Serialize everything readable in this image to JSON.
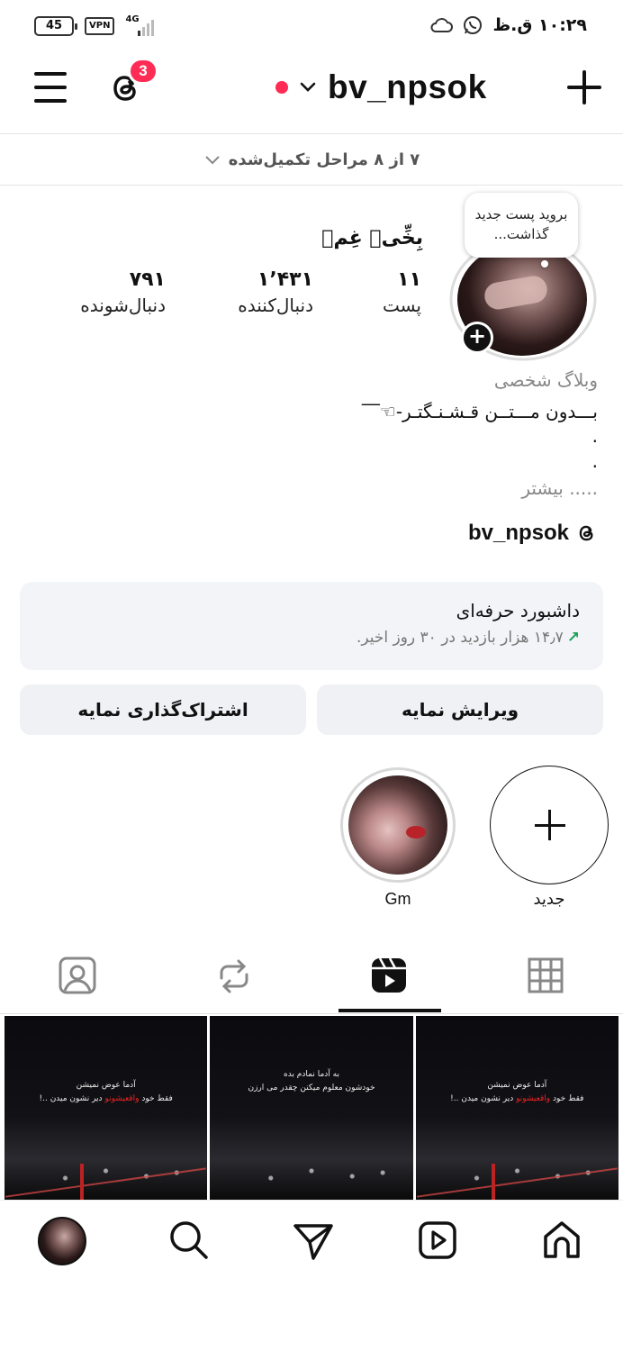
{
  "status_bar": {
    "battery": "45",
    "vpn": "VPN",
    "network": "4G",
    "time": "۱۰:۲۹ ق.ظ"
  },
  "header": {
    "username": "bv_npsok",
    "threads_badge": "3"
  },
  "setup_steps": {
    "text": "۷ از ۸ مراحل تکمیل‌شده"
  },
  "profile": {
    "note_bubble": "بروید پست جدید گذاشت...",
    "display_name": "بِخِّیٖ غِمٖ",
    "stats": [
      {
        "value": "۱۱",
        "label": "پست"
      },
      {
        "value": "۱٬۴۳۱",
        "label": "دنبال‌کننده"
      },
      {
        "value": "۷۹۱",
        "label": "دنبال‌شونده"
      }
    ],
    "category": "وبلاگ شخصی",
    "bio_line1": "بـــدون مـــتــن قـشـنـگتـر-☜‾‾",
    "bio_dot1": ".",
    "bio_dot2": ".",
    "more": "..... بیشتر",
    "threads_username": "bv_npsok"
  },
  "dashboard": {
    "title": "داشبورد حرفه‌ای",
    "stat": "۱۴٫۷ هزار بازدید در ۳۰ روز اخیر."
  },
  "buttons": {
    "edit_profile": "ویرایش نمایه",
    "share_profile": "اشتراک‌گذاری نمایه"
  },
  "highlights": [
    {
      "label": "جدید"
    },
    {
      "label": "Gm"
    }
  ],
  "grid_posts": [
    {
      "caption_l1": "آدما عوض نمیشن",
      "caption_l2a": "فقط خود ",
      "caption_red": "واقعیشونو",
      "caption_l2b": " دیر نشون میدن ..!"
    },
    {
      "caption_l1": "به آدما نمادم بده",
      "caption_l2a": "خودشون معلوم میکنن چقدر می ارزن",
      "caption_red": "",
      "caption_l2b": ""
    },
    {
      "caption_l1": "آدما عوض نمیشن",
      "caption_l2a": "فقط خود ",
      "caption_red": "واقعیشونو",
      "caption_l2b": " دیر نشون میدن ..!"
    }
  ],
  "colors": {
    "accent_red": "#ff2d55",
    "growth_green": "#1aa05a",
    "card_bg": "#f3f4f7"
  }
}
